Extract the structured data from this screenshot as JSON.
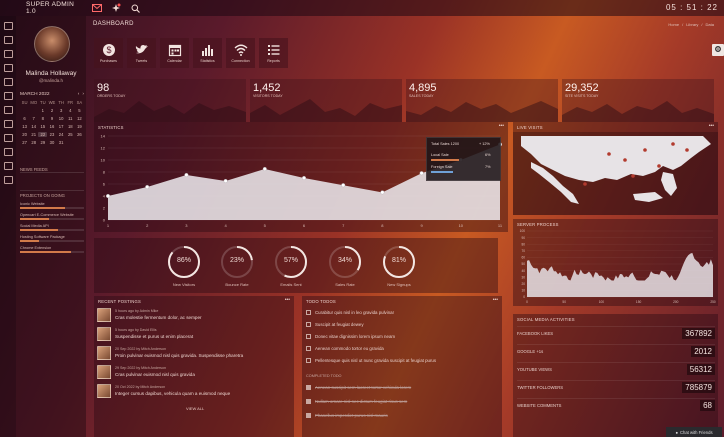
{
  "app": {
    "title": "SUPER ADMIN 1.0",
    "clock": "05 : 51 : 22"
  },
  "user": {
    "name": "Malinda Hollaway",
    "handle": "@malinda.h"
  },
  "calendar": {
    "month": "MARCH 2022",
    "days": [
      "SU",
      "MO",
      "TU",
      "WE",
      "TH",
      "FR",
      "SA"
    ],
    "dates": [
      "",
      "",
      "1",
      "2",
      "3",
      "4",
      "5",
      "6",
      "7",
      "8",
      "9",
      "10",
      "11",
      "12",
      "13",
      "14",
      "15",
      "16",
      "17",
      "18",
      "19",
      "20",
      "21",
      "22",
      "23",
      "24",
      "25",
      "26",
      "27",
      "28",
      "29",
      "30",
      "31",
      "",
      ""
    ],
    "today": "22"
  },
  "sidebar": {
    "news_title": "NEWS FEEDS",
    "projects_title": "PROJECTS ON GOING",
    "projects": [
      {
        "name": "Iconic Website",
        "progress": 0.7
      },
      {
        "name": "Opencart E-Commerce Website",
        "progress": 0.45
      },
      {
        "name": "Social Media API",
        "progress": 0.6
      },
      {
        "name": "Hosting Software Package",
        "progress": 0.3
      },
      {
        "name": "Chrome Extension",
        "progress": 0.8
      }
    ]
  },
  "page": {
    "title": "DASHBOARD",
    "breadcrumbs": [
      "Home",
      "Library",
      "Data"
    ]
  },
  "quick_buttons": [
    {
      "label": "Purchases",
      "icon": "dollar-icon"
    },
    {
      "label": "Tweets",
      "icon": "twitter-icon"
    },
    {
      "label": "Calendar",
      "icon": "calendar-icon"
    },
    {
      "label": "Statistics",
      "icon": "bar-chart-icon"
    },
    {
      "label": "Connection",
      "icon": "wifi-icon"
    },
    {
      "label": "Reports",
      "icon": "list-icon"
    }
  ],
  "stats": [
    {
      "value": "98",
      "label": "ORDERS TODAY"
    },
    {
      "value": "1,452",
      "label": "VISITORS TODAY"
    },
    {
      "value": "4,895",
      "label": "SALES TODAY"
    },
    {
      "value": "29,352",
      "label": "SITE VISITS TODAY"
    }
  ],
  "statistics_panel": {
    "title": "STATISTICS",
    "tooltip": {
      "title": "Total Sales 1200",
      "change": "+ 12%",
      "rows": [
        {
          "label": "Local Sale",
          "value": "6%"
        },
        {
          "label": "Foreign Sale",
          "value": "7%"
        }
      ]
    }
  },
  "chart_data": {
    "type": "area",
    "x": [
      1,
      2,
      3,
      4,
      5,
      6,
      7,
      8,
      9,
      10,
      11
    ],
    "xticks": [
      "1",
      "2",
      "3",
      "4",
      "5",
      "6",
      "7",
      "8",
      "9",
      "10",
      "11"
    ],
    "yticks": [
      "0",
      "2",
      "4",
      "6",
      "8",
      "10",
      "12",
      "14"
    ],
    "ylim": [
      0,
      14
    ],
    "values": [
      4,
      5.5,
      7.5,
      6.5,
      8.5,
      7,
      5.8,
      4.6,
      7.8,
      10,
      12.6
    ],
    "grid": true
  },
  "gauges": [
    {
      "value": "86%",
      "label": "New Visitors",
      "percent": 86
    },
    {
      "value": "23%",
      "label": "Bounce Rate",
      "percent": 23
    },
    {
      "value": "57%",
      "label": "Emails Sent",
      "percent": 57
    },
    {
      "value": "34%",
      "label": "Sales Rate",
      "percent": 34
    },
    {
      "value": "81%",
      "label": "New Signups",
      "percent": 81
    }
  ],
  "recent_postings": {
    "title": "RECENT POSTINGS",
    "items": [
      {
        "meta": "5 hours ago by Admin Mike",
        "text": "Cras molestie fermentum dolor, ac semper"
      },
      {
        "meta": "5 hours ago by David Ellis",
        "text": "Suspendisse et purus ut enim placerat"
      },
      {
        "meta": "20 Sep 2022 by Mitch Anderson",
        "text": "Proin pulvinar euismod nisl quis gravida. Suspendisse pharetra"
      },
      {
        "meta": "29 Sep 2022 by Mitch Anderson",
        "text": "Cras pulvinar euismod nisl quis gravida"
      },
      {
        "meta": "20 Oct 2022 by Mitch Anderson",
        "text": "Integer cursus dapibus, vehicula quam a euismod neque"
      }
    ],
    "view_all": "VIEW ALL"
  },
  "todos": {
    "title": "TODO TODOS",
    "items": [
      "Curabitur quis nisl in leo gravida pulvinar",
      "Suscipit at feugiat dewey",
      "Donec vitae dignissim lorem ipsum neam",
      "Aenean commodo tortor eu gravida",
      "Pellentesque quis nisl ut nunc gravida suscipit at feugiat purus"
    ],
    "completed_title": "COMPLETED TODO",
    "completed": [
      "Aenean suscipit sem laoreet tortor vehicula lorem",
      "Nullam ornare nisl nec dictum feugiat risus sem",
      "Phasellus imperdiet purus nisl mauris"
    ]
  },
  "map_panel": {
    "title": "LIVE VISITS"
  },
  "server_panel": {
    "title": "SERVER PROCESS",
    "yticks": [
      "0",
      "10",
      "20",
      "30",
      "40",
      "50",
      "60",
      "70",
      "80",
      "90",
      "100"
    ],
    "xticks": [
      "0",
      "50",
      "100",
      "150",
      "200",
      "250"
    ]
  },
  "social": {
    "title": "SOCIAL MEDIA ACTIVITIES",
    "rows": [
      {
        "label": "FACEBOOK LIKES",
        "value": "367892"
      },
      {
        "label": "GOOGLE +1s",
        "value": "2012"
      },
      {
        "label": "YOUTUBE VIEWS",
        "value": "56312"
      },
      {
        "label": "TWITTER FOLLOWERS",
        "value": "785879"
      },
      {
        "label": "WEBSITE COMMENTS",
        "value": "68"
      }
    ]
  },
  "chat": {
    "label": "Chat with Friends"
  },
  "colors": {
    "accent": "#d27a4a",
    "panel": "#3c0f1b",
    "chart_fill": "#e9e6ea"
  }
}
